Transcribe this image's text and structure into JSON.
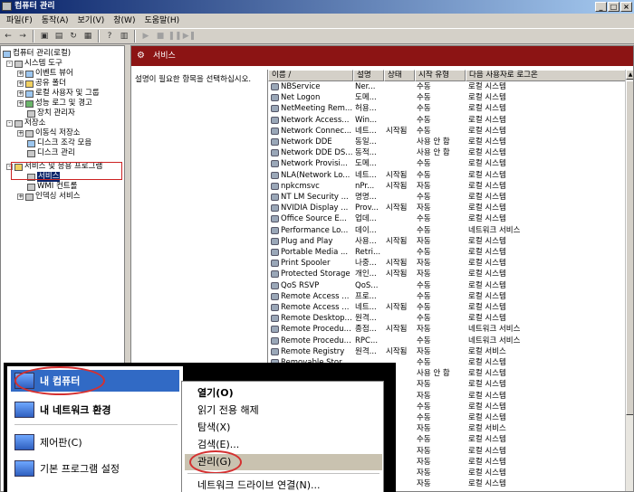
{
  "window": {
    "title": "컴퓨터 관리",
    "btn_min": "_",
    "btn_max": "□",
    "btn_close": "×"
  },
  "menubar": [
    "파일(F)",
    "동작(A)",
    "보기(V)",
    "창(W)",
    "도움말(H)"
  ],
  "toolbar": {
    "back": "←",
    "forward": "→",
    "up": "▣",
    "props": "▤",
    "refresh": "↻",
    "export": "▦",
    "help": "?",
    "view": "▥",
    "play": "▶",
    "stop": "■",
    "pause": "❚❚",
    "restart": "▶❚"
  },
  "tree": {
    "root": "컴퓨터 관리(로컬)",
    "system_tools": "시스템 도구",
    "event_viewer": "이벤트 뷰어",
    "shared_folders": "공유 폴더",
    "local_users": "로컬 사용자 및 그룹",
    "perf_logs": "성능 로그 및 경고",
    "device_manager": "장치 관리자",
    "storage": "저장소",
    "removable": "이동식 저장소",
    "defrag": "디스크 조각 모음",
    "disk_mgmt": "디스크 관리",
    "services_apps": "서비스 및 응용 프로그램",
    "services": "서비스",
    "wmi": "WMI 컨트롤",
    "indexing": "인덱싱 서비스"
  },
  "pane": {
    "header": "서비스",
    "description": "설명이 필요한 항목을 선택하십시오."
  },
  "columns": [
    "이름 /",
    "설명",
    "상태",
    "시작 유형",
    "다음 사용자로 로그온"
  ],
  "services": [
    [
      "NBService",
      "Ner...",
      "",
      "수동",
      "로컬 시스템"
    ],
    [
      "Net Logon",
      "도메...",
      "",
      "수동",
      "로컬 시스템"
    ],
    [
      "NetMeeting Rem...",
      "허용...",
      "",
      "수동",
      "로컬 시스템"
    ],
    [
      "Network Access...",
      "Win...",
      "",
      "수동",
      "로컬 시스템"
    ],
    [
      "Network Connec...",
      "네트...",
      "시작됨",
      "수동",
      "로컬 시스템"
    ],
    [
      "Network DDE",
      "동일...",
      "",
      "사용 안 함",
      "로컬 시스템"
    ],
    [
      "Network DDE DS...",
      "동적...",
      "",
      "사용 안 함",
      "로컬 시스템"
    ],
    [
      "Network Provisi...",
      "도메...",
      "",
      "수동",
      "로컬 시스템"
    ],
    [
      "NLA(Network Lo...",
      "네트...",
      "시작됨",
      "수동",
      "로컬 시스템"
    ],
    [
      "npkcmsvc",
      "nPr...",
      "시작됨",
      "자동",
      "로컬 시스템"
    ],
    [
      "NT LM Security ...",
      "명명...",
      "",
      "수동",
      "로컬 시스템"
    ],
    [
      "NVIDIA Display ...",
      "Prov...",
      "시작됨",
      "자동",
      "로컬 시스템"
    ],
    [
      "Office Source E...",
      "업데...",
      "",
      "수동",
      "로컬 시스템"
    ],
    [
      "Performance Lo...",
      "데이...",
      "",
      "수동",
      "네트워크 서비스"
    ],
    [
      "Plug and Play",
      "사용...",
      "시작됨",
      "자동",
      "로컬 시스템"
    ],
    [
      "Portable Media ...",
      "Retri...",
      "",
      "수동",
      "로컬 시스템"
    ],
    [
      "Print Spooler",
      "나중...",
      "시작됨",
      "자동",
      "로컬 시스템"
    ],
    [
      "Protected Storage",
      "개인...",
      "시작됨",
      "자동",
      "로컬 시스템"
    ],
    [
      "QoS RSVP",
      "QoS...",
      "",
      "수동",
      "로컬 시스템"
    ],
    [
      "Remote Access ...",
      "프로...",
      "",
      "수동",
      "로컬 시스템"
    ],
    [
      "Remote Access ...",
      "네트...",
      "시작됨",
      "수동",
      "로컬 시스템"
    ],
    [
      "Remote Desktop...",
      "원격...",
      "",
      "수동",
      "로컬 시스템"
    ],
    [
      "Remote Procedu...",
      "종점...",
      "시작됨",
      "자동",
      "네트워크 서비스"
    ],
    [
      "Remote Procedu...",
      "RPC...",
      "",
      "수동",
      "네트워크 서비스"
    ],
    [
      "Remote Registry",
      "원격...",
      "시작됨",
      "자동",
      "로컬 서비스"
    ],
    [
      "Removable Stor...",
      "",
      "",
      "수동",
      "로컬 시스템"
    ],
    [
      "",
      "",
      "",
      "사용 안 함",
      "로컬 시스템"
    ],
    [
      "",
      "",
      "",
      "자동",
      "로컬 시스템"
    ],
    [
      "",
      "",
      "",
      "자동",
      "로컬 시스템"
    ],
    [
      "",
      "",
      "",
      "수동",
      "로컬 시스템"
    ],
    [
      "",
      "",
      "",
      "수동",
      "로컬 시스템"
    ],
    [
      "",
      "",
      "",
      "자동",
      "로컬 서비스"
    ],
    [
      "",
      "",
      "",
      "수동",
      "로컬 시스템"
    ],
    [
      "",
      "",
      "",
      "자동",
      "로컬 시스템"
    ],
    [
      "",
      "",
      "",
      "자동",
      "로컬 시스템"
    ],
    [
      "",
      "",
      "",
      "자동",
      "로컬 시스템"
    ],
    [
      "",
      "",
      "",
      "자동",
      "로컬 시스템"
    ]
  ],
  "startmenu": {
    "my_computer": "내 컴퓨터",
    "network": "내 네트워크 환경",
    "control_panel": "제어판(C)",
    "default_programs": "기본 프로그램 설정"
  },
  "context_menu": [
    "열기(O)",
    "읽기 전용 해제",
    "탐색(X)",
    "검색(E)...",
    "관리(G)",
    "네트워크 드라이브 연결(N)..."
  ]
}
